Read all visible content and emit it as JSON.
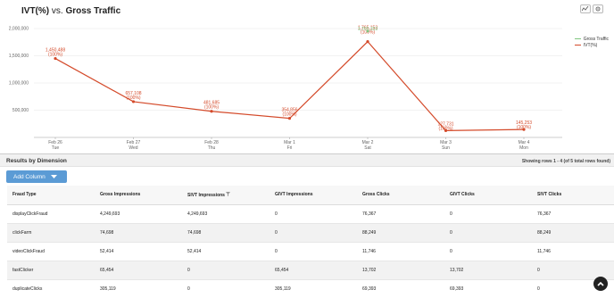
{
  "header": {
    "metric": "IVT(%)",
    "vs": " vs. ",
    "dimension": "Gross Traffic"
  },
  "colors": {
    "ivt_line": "#d44a2a",
    "gross_line": "#7fc67f",
    "header_btn": "#5b9bd5",
    "grid": "#e6e6e6"
  },
  "chart_data": {
    "type": "line",
    "x": [
      "Feb 26",
      "Feb 27",
      "Feb 28",
      "Mar 1",
      "Mar 2",
      "Mar 3",
      "Mar 4"
    ],
    "x_days": [
      "Tue",
      "Wed",
      "Thu",
      "Fri",
      "Sat",
      "Sun",
      "Mon"
    ],
    "ylim": [
      0,
      2000000
    ],
    "yticks": [
      500000,
      1000000,
      1500000,
      2000000
    ],
    "ytick_labels": [
      "500,000",
      "1,000,000",
      "1,500,000",
      "2,000,000"
    ],
    "legend_position": "top-right",
    "series": [
      {
        "name": "Gross Traffic",
        "color": "#7fc67f",
        "values": [
          null,
          null,
          null,
          null,
          1950000,
          null,
          null
        ],
        "labels": [
          "",
          "",
          "",
          "",
          "1,765,153",
          "",
          ""
        ]
      },
      {
        "name": "IVT(%)",
        "color": "#d44a2a",
        "values": [
          1450000,
          657000,
          480000,
          350000,
          1760000,
          125000,
          145000
        ],
        "labels": [
          "1,450,488",
          "657,108",
          "481,685",
          "354,856",
          "1,765,153",
          "127,731",
          "145,253"
        ],
        "sublabels": [
          "(100%)",
          "(100%)",
          "(100%)",
          "(100%)",
          "(100%)",
          "(100%)",
          "(100%)"
        ]
      }
    ]
  },
  "results": {
    "title": "Results by Dimension",
    "row_count": "Showing rows 1 - 4 (of 5 total rows found)",
    "add_column": "Add Column",
    "columns": [
      "Fraud Type",
      "Gross Impressions",
      "SIVT Impressions",
      "GIVT Impressions",
      "Gross Clicks",
      "GIVT Clicks",
      "SIVT Clicks"
    ],
    "rows": [
      [
        "displayClickFraud",
        "4,249,693",
        "4,249,693",
        "0",
        "76,367",
        "0",
        "76,367"
      ],
      [
        "clickFarm",
        "74,698",
        "74,698",
        "0",
        "88,249",
        "0",
        "88,249"
      ],
      [
        "videoClickFraud",
        "52,414",
        "52,414",
        "0",
        "11,746",
        "0",
        "11,746"
      ],
      [
        "fastClicker",
        "65,454",
        "0",
        "65,454",
        "13,702",
        "13,702",
        "0"
      ],
      [
        "duplicateClicks",
        "305,119",
        "0",
        "305,119",
        "69,393",
        "69,393",
        "0"
      ]
    ]
  }
}
